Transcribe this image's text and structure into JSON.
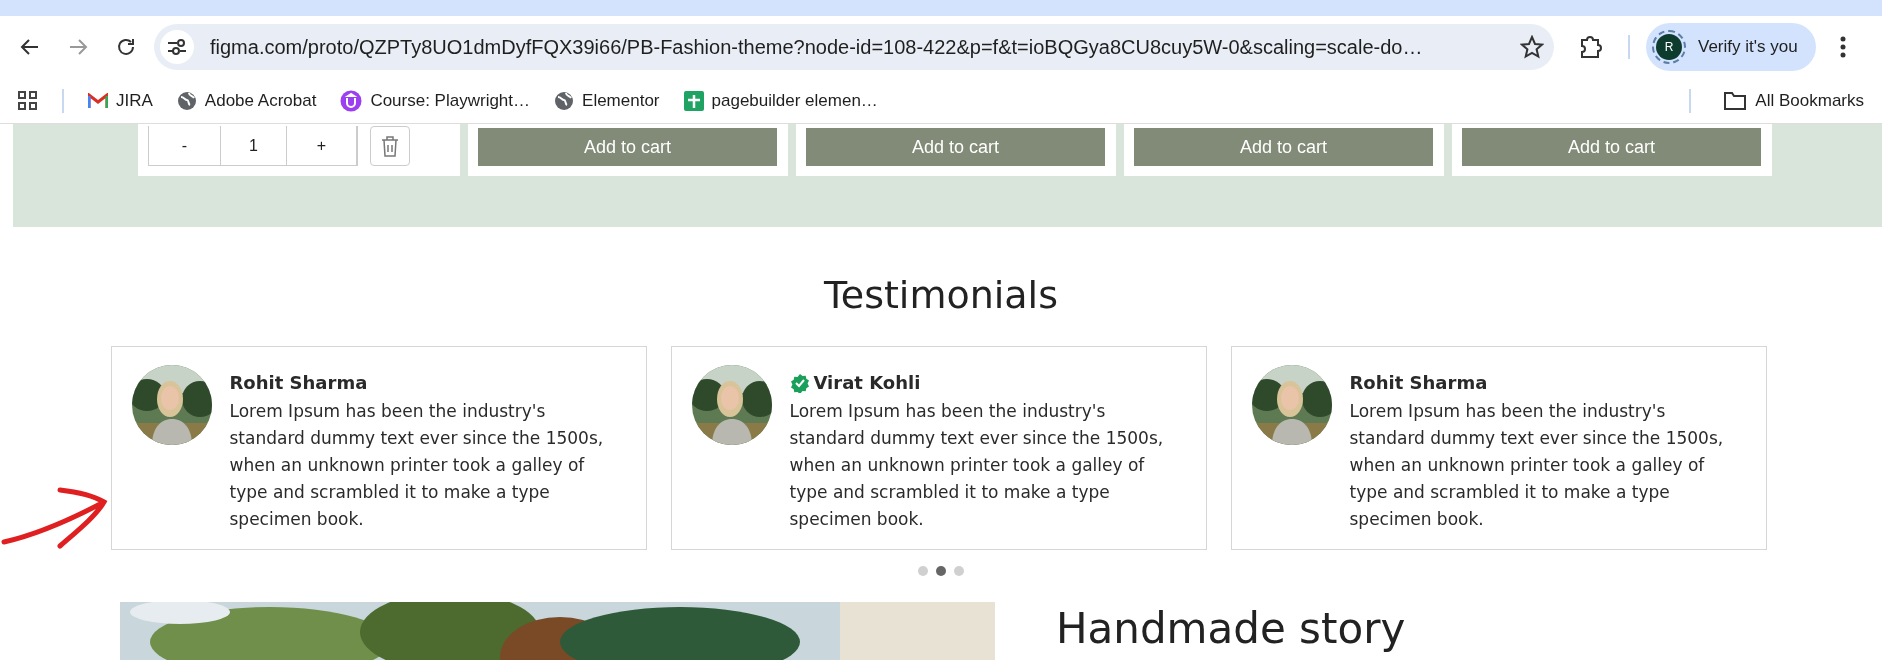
{
  "browser": {
    "url": "figma.com/proto/QZPTy8UO1dmDyfFQX39i66/PB-Fashion-theme?node-id=108-422&p=f&t=ioBQGya8CU8cuy5W-0&scaling=scale-do…",
    "profile_initial": "R",
    "verify_label": "Verify it's you",
    "bookmarks": [
      {
        "kind": "mail",
        "label": "JIRA"
      },
      {
        "kind": "globe",
        "label": "Adobe Acrobat"
      },
      {
        "kind": "course",
        "label": "Course: Playwright…"
      },
      {
        "kind": "globe",
        "label": "Elementor"
      },
      {
        "kind": "sheet",
        "label": "pagebuilder elemen…"
      }
    ],
    "all_bookmarks": "All Bookmarks"
  },
  "products": {
    "quantity": {
      "minus": "-",
      "value": "1",
      "plus": "+"
    },
    "buttons": [
      "Add to cart",
      "Add to cart",
      "Add to cart",
      "Add to cart"
    ]
  },
  "testimonials": {
    "title": "Testimonials",
    "cards": [
      {
        "name": "Rohit Sharma",
        "verified": false,
        "text": "Lorem Ipsum has been the industry's standard dummy text ever since the 1500s, when an unknown printer took a galley of type and scrambled it to make a type specimen book."
      },
      {
        "name": "Virat Kohli",
        "verified": true,
        "text": "Lorem Ipsum has been the industry's standard dummy text ever since the 1500s, when an unknown printer took a galley of type and scrambled it to make a type specimen book."
      },
      {
        "name": "Rohit Sharma",
        "verified": false,
        "text": "Lorem Ipsum has been the industry's standard dummy text ever since the 1500s, when an unknown printer took a galley of type and scrambled it to make a type specimen book."
      }
    ],
    "dots": [
      {
        "selected": false
      },
      {
        "selected": true
      },
      {
        "selected": false
      }
    ]
  },
  "story": {
    "title": "Handmade story"
  }
}
